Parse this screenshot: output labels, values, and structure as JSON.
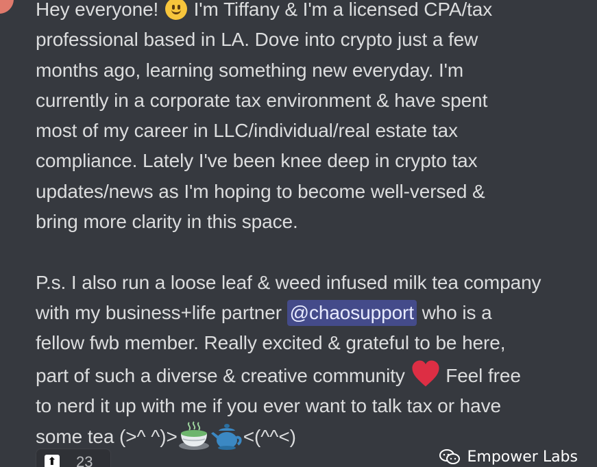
{
  "message": {
    "line1": "Hey everyone!",
    "line1_after": "I'm Tiffany & I'm a licensed CPA/tax",
    "line2": "professional based in LA. Dove into crypto just a few",
    "line3": "months ago, learning something new everyday. I'm",
    "line4": "currently in a corporate tax environment & have spent",
    "line5": "most of my career in LLC/individual/real estate tax",
    "line6": "compliance. Lately I've been knee deep in crypto tax",
    "line7": "updates/news as I'm hoping to become well-versed &",
    "line8": "bring more clarity in this space.",
    "ps_line1": "P.s. I also run a loose leaf & weed infused milk tea company",
    "ps_line2_before": "with my business+life partner",
    "mention": "@chaosupport",
    "ps_line2_after": "who is a",
    "ps_line3": "fellow fwb member. Really excited & grateful to be here,",
    "ps_line4_before": "part of such a diverse & creative community",
    "ps_line4_after": "Feel free",
    "ps_line5": "to nerd it up with me if you ever want to talk tax or have",
    "ps_line6_before": "some tea (>^ ^)>",
    "ps_line6_after": "<(^^<)"
  },
  "icons": {
    "smiley": "slightly-smiling-face-icon",
    "heart": "red-heart-icon",
    "teacup": "green-tea-cup-icon",
    "teapot": "teapot-icon",
    "reaction": "up-arrow-icon",
    "watermark": "wechat-icon"
  },
  "reaction": {
    "count": "23"
  },
  "watermark": {
    "text": "Empower Labs"
  },
  "colors": {
    "background": "#36393f",
    "text": "#dcddde",
    "mention_bg": "#4d5491",
    "heart": "#dd2e44",
    "teacup": "#6db56d",
    "teapot": "#3b88c3"
  }
}
